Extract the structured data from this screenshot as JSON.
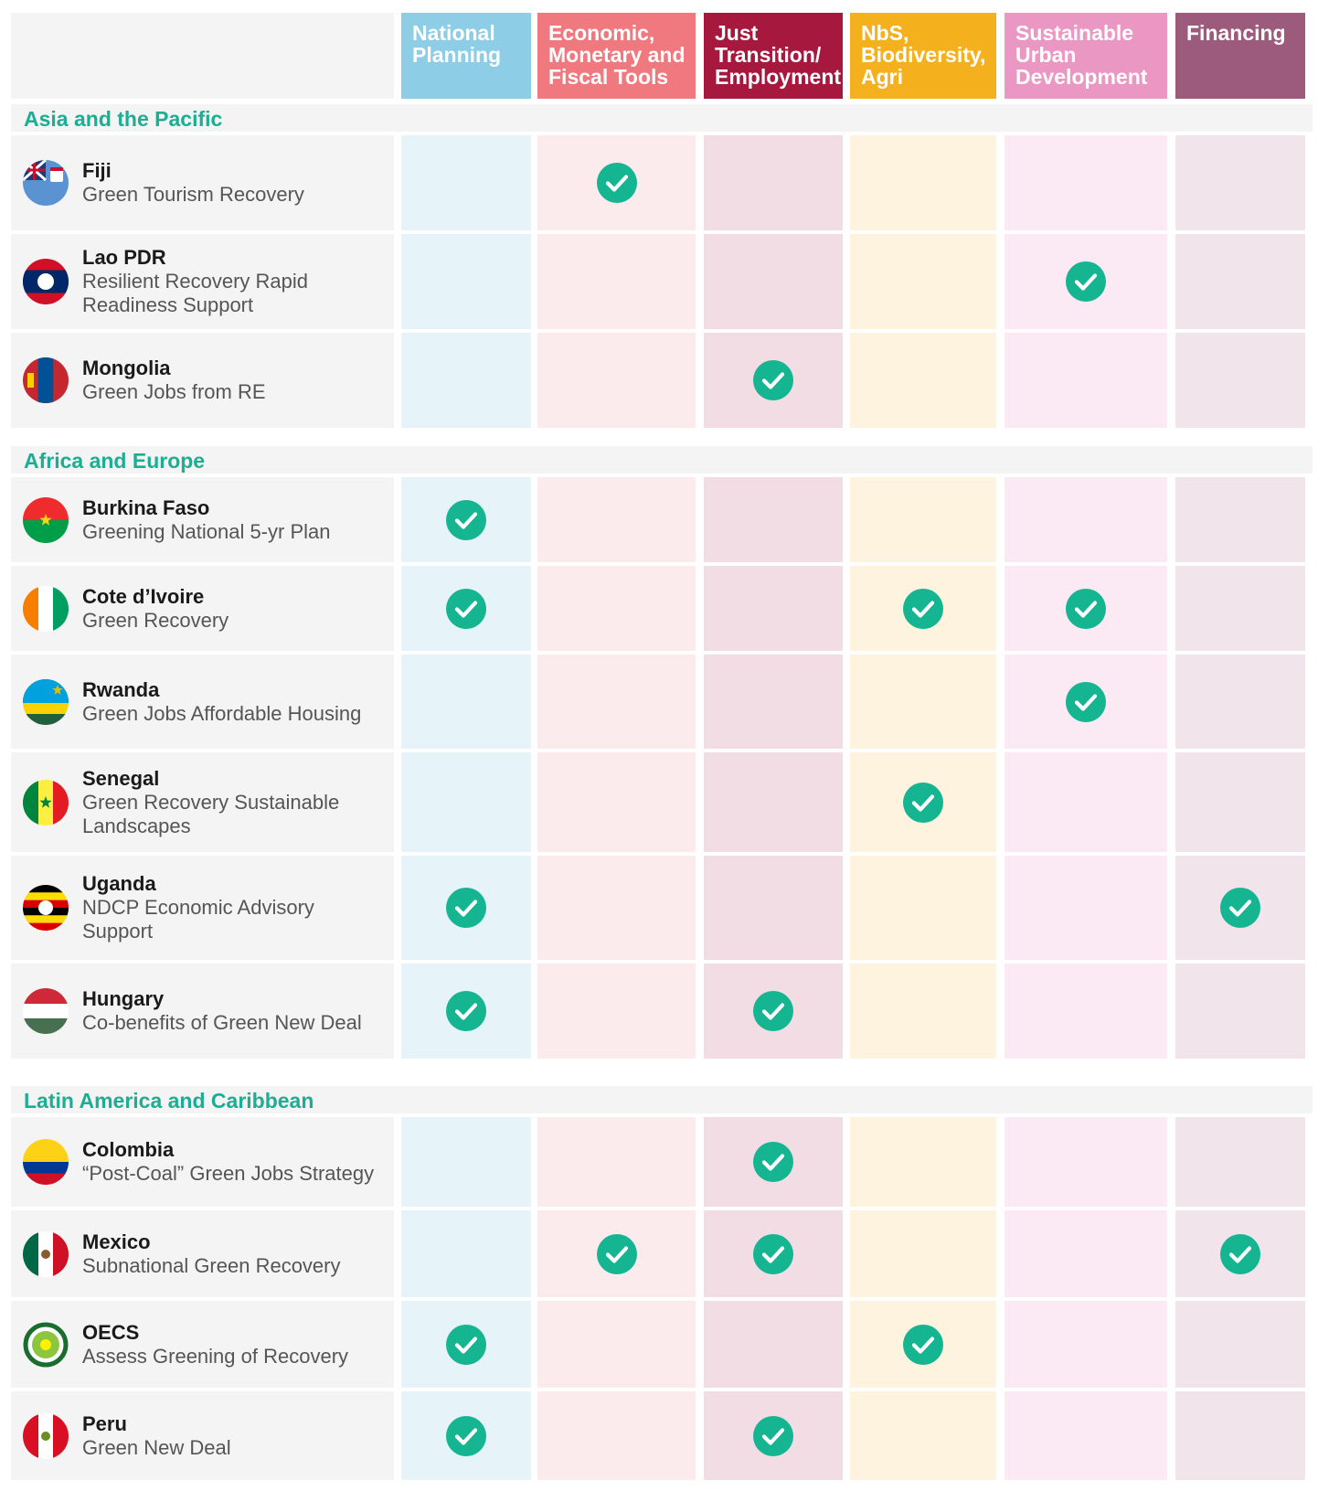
{
  "headers": [
    {
      "label": "National\nPlanning",
      "color": "#8dcde6",
      "tint": "#e6f4f9"
    },
    {
      "label": "Economic,\nMonetary and\nFiscal Tools",
      "color": "#f0787f",
      "tint": "#fcebed"
    },
    {
      "label": "Just\nTransition/\nEmployment",
      "color": "#a7183f",
      "tint": "#f1dde3"
    },
    {
      "label": "NbS,\nBiodiversity,\nAgri",
      "color": "#f5b11d",
      "tint": "#fdf3de"
    },
    {
      "label": "Sustainable\nUrban\nDevelopment",
      "color": "#eb97c3",
      "tint": "#fbeaf3"
    },
    {
      "label": "Financing",
      "color": "#9c5b7c",
      "tint": "#f1e4ea"
    }
  ],
  "sections": [
    {
      "title": "Asia and the Pacific",
      "rows": [
        {
          "country": "Fiji",
          "project": "Green Tourism Recovery",
          "flag": "fiji-flag-icon",
          "checks": [
            false,
            true,
            false,
            false,
            false,
            false
          ]
        },
        {
          "country": "Lao PDR",
          "project": "Resilient Recovery Rapid\nReadiness Support",
          "flag": "laos-flag-icon",
          "checks": [
            false,
            false,
            false,
            false,
            true,
            false
          ]
        },
        {
          "country": "Mongolia",
          "project": "Green Jobs from RE",
          "flag": "mongolia-flag-icon",
          "checks": [
            false,
            false,
            true,
            false,
            false,
            false
          ]
        }
      ]
    },
    {
      "title": "Africa and Europe",
      "rows": [
        {
          "country": "Burkina Faso",
          "project": "Greening National 5-yr Plan",
          "flag": "burkina-faso-flag-icon",
          "checks": [
            true,
            false,
            false,
            false,
            false,
            false
          ]
        },
        {
          "country": "Cote d’Ivoire",
          "project": "Green Recovery",
          "flag": "cote-divoire-flag-icon",
          "checks": [
            true,
            false,
            false,
            true,
            true,
            false
          ]
        },
        {
          "country": "Rwanda",
          "project": "Green Jobs Affordable Housing",
          "flag": "rwanda-flag-icon",
          "checks": [
            false,
            false,
            false,
            false,
            true,
            false
          ]
        },
        {
          "country": "Senegal",
          "project": "Green Recovery Sustainable\nLandscapes",
          "flag": "senegal-flag-icon",
          "checks": [
            false,
            false,
            false,
            true,
            false,
            false
          ]
        },
        {
          "country": "Uganda",
          "project": "NDCP Economic Advisory\nSupport",
          "flag": "uganda-flag-icon",
          "checks": [
            true,
            false,
            false,
            false,
            false,
            true
          ]
        },
        {
          "country": "Hungary",
          "project": "Co-benefits of Green New Deal",
          "flag": "hungary-flag-icon",
          "checks": [
            true,
            false,
            true,
            false,
            false,
            false
          ]
        }
      ]
    },
    {
      "title": "Latin America and Caribbean",
      "rows": [
        {
          "country": "Colombia",
          "project": "“Post-Coal” Green Jobs Strategy",
          "flag": "colombia-flag-icon",
          "checks": [
            false,
            false,
            true,
            false,
            false,
            false
          ]
        },
        {
          "country": "Mexico",
          "project": "Subnational Green Recovery",
          "flag": "mexico-flag-icon",
          "checks": [
            false,
            true,
            true,
            false,
            false,
            true
          ]
        },
        {
          "country": "OECS",
          "project": "Assess Greening of Recovery",
          "flag": "oecs-logo-icon",
          "checks": [
            true,
            false,
            false,
            true,
            false,
            false
          ]
        },
        {
          "country": "Peru",
          "project": "Green New Deal",
          "flag": "peru-flag-icon",
          "checks": [
            true,
            false,
            true,
            false,
            false,
            false
          ]
        }
      ]
    }
  ]
}
